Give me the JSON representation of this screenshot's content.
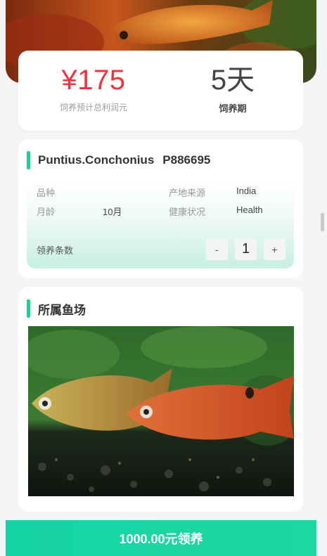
{
  "summary": {
    "price": "¥175",
    "price_caption": "饲养预计总利润元",
    "days": "5天",
    "days_caption": "饲养期"
  },
  "fish": {
    "name": "Puntius.Conchonius",
    "code": "P886695",
    "rows": [
      {
        "label1": "品种",
        "value1": "",
        "label2": "产地来源",
        "value2": "India"
      },
      {
        "label1": "月龄",
        "value1": "10月",
        "label2": "健康状况",
        "value2": "Health"
      }
    ],
    "quantity_label": "领养条数",
    "minus_label": "-",
    "quantity": "1",
    "plus_label": "+"
  },
  "farm": {
    "title": "所属鱼场"
  },
  "adopt_button": "1000.00元领养"
}
